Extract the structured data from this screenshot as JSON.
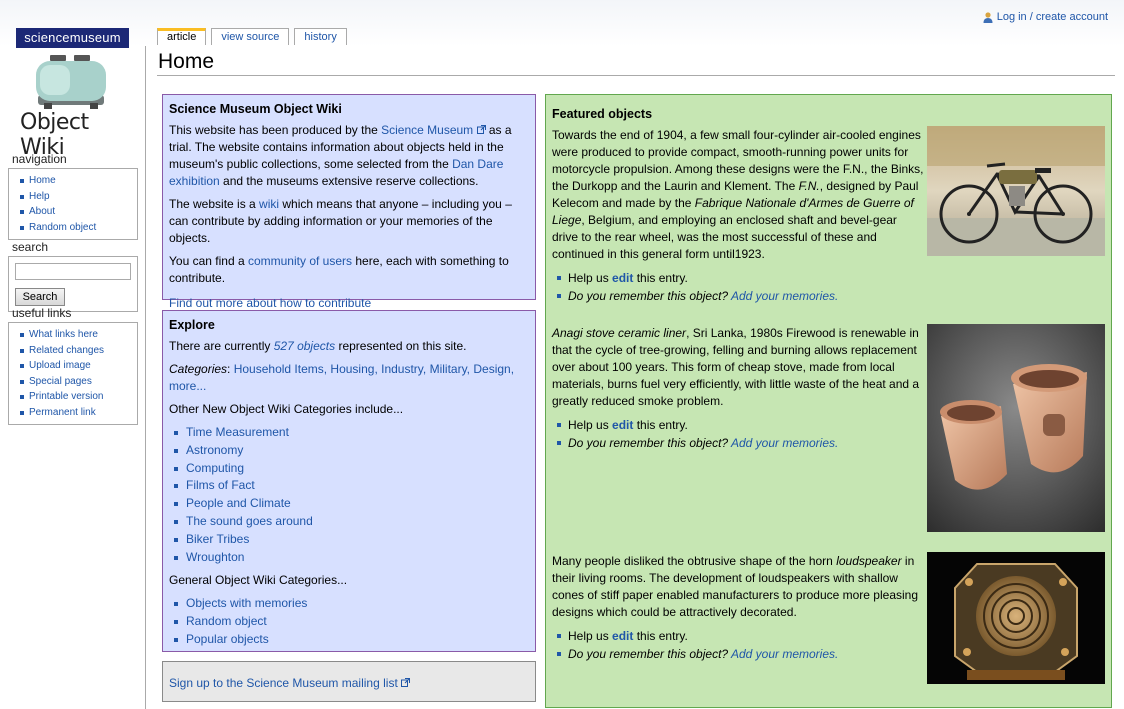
{
  "personal": {
    "login_label": "Log in / create account"
  },
  "logo": {
    "brand": "sciencemuseum",
    "wiki_title": "Object Wiki"
  },
  "tabs": [
    {
      "label": "article",
      "selected": true
    },
    {
      "label": "view source",
      "selected": false
    },
    {
      "label": "history",
      "selected": false
    }
  ],
  "page": {
    "title": "Home"
  },
  "sidebar": {
    "navigation": {
      "title": "navigation",
      "items": [
        "Home",
        "Help",
        "About",
        "Random object"
      ]
    },
    "search": {
      "title": "search",
      "input_value": "",
      "button_label": "Search"
    },
    "useful_links": {
      "title": "useful links",
      "items": [
        "What links here",
        "Related changes",
        "Upload image",
        "Special pages",
        "Printable version",
        "Permanent link"
      ]
    }
  },
  "intro": {
    "heading": "Science Museum Object Wiki",
    "p1_a": "This website has been produced by the ",
    "p1_link1": "Science Museum",
    "p1_b": " as a trial. The website contains information about objects held in the museum's public collections, some selected from the ",
    "p1_link2": "Dan Dare exhibition",
    "p1_c": " and the museums extensive reserve collections.",
    "p2_a": "The website is a ",
    "p2_link": "wiki",
    "p2_b": " which means that anyone – including you – can contribute by adding information or your memories of the objects.",
    "p3_a": "You can find a ",
    "p3_link": "community of users",
    "p3_b": " here, each with something to contribute.",
    "contribute_link": "Find out more about how to contribute"
  },
  "explore": {
    "heading": "Explore",
    "count_a": "There are currently ",
    "count_link": "527 objects",
    "count_b": " represented on this site.",
    "categories_label": "Categories",
    "categories_sep": ": ",
    "categories_links": "Household Items, Housing, Industry, Military, Design, more...",
    "new_cats_label": "Other New Object Wiki Categories include...",
    "new_cats": [
      "Time Measurement",
      "Astronomy",
      "Computing",
      "Films of Fact",
      "People and Climate",
      "The sound goes around",
      "Biker Tribes",
      "Wroughton"
    ],
    "general_label": "General Object Wiki Categories...",
    "general_cats": [
      "Objects with memories",
      "Random object",
      "Popular objects"
    ]
  },
  "mailing": {
    "link": "Sign up to the Science Museum mailing list"
  },
  "featured": {
    "heading": "Featured objects",
    "help_a": "Help us ",
    "help_edit": "edit",
    "help_b": " this entry.",
    "remember_a": "Do you remember this object? ",
    "remember_link": "Add your memories.",
    "item1": {
      "t1": "Towards the end of 1904, a few small four-cylinder air-cooled engines were produced to provide compact, smooth-running power units for motorcycle propulsion. Among these designs were the F.N., the Binks, the Durkopp and the Laurin and Klement. The ",
      "t2": "F.N.",
      "t3": ", designed by Paul Kelecom and made by the ",
      "t4": "Fabrique Nationale d'Armes de Guerre of Liege",
      "t5": ", Belgium, and employing an enclosed shaft and bevel-gear drive to the rear wheel, was the most successful of these and continued in this general form until1923."
    },
    "item2": {
      "t1": "Anagi stove ceramic liner",
      "t2": ", Sri Lanka, 1980s Firewood is renewable in that the cycle of tree-growing, felling and burning allows replacement over about 100 years. This form of cheap stove, made from local materials, burns fuel very efficiently, with little waste of the heat and a greatly reduced smoke problem."
    },
    "item3": {
      "t1": "Many people disliked the obtrusive shape of the horn ",
      "t2": "loudspeaker",
      "t3": " in their living rooms. The development of loudspeakers with shallow cones of stiff paper enabled manufacturers to produce more pleasing designs which could be attractively decorated."
    }
  },
  "colors": {
    "link": "#1f56a8",
    "intro_bg": "#d7e0ff",
    "featured_bg": "#c6e6b3",
    "brand_bg": "#1c2876",
    "tab_accent": "#fabd23"
  },
  "icons": [
    "user-icon",
    "toaster-logo-icon",
    "external-link-icon",
    "motorcycle-image",
    "ceramic-stove-image",
    "loudspeaker-image"
  ]
}
